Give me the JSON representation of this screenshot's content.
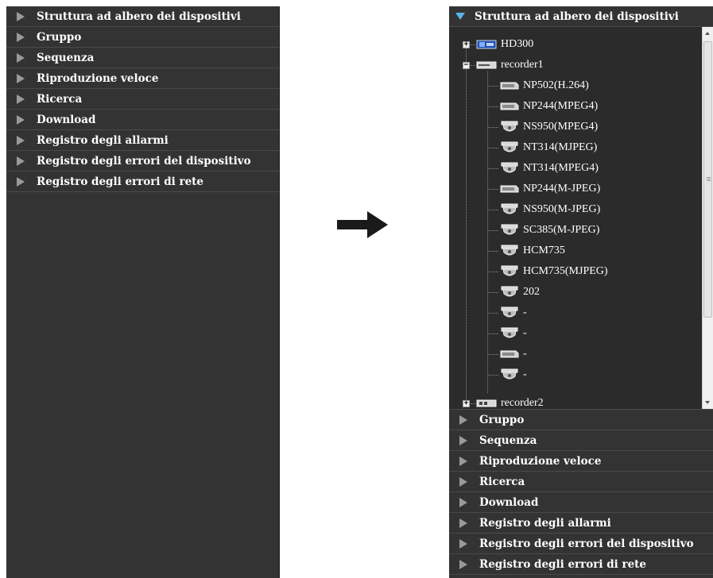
{
  "left_panel": {
    "items": [
      {
        "label": "Struttura ad albero dei dispositivi"
      },
      {
        "label": "Gruppo"
      },
      {
        "label": "Sequenza"
      },
      {
        "label": "Riproduzione veloce"
      },
      {
        "label": "Ricerca"
      },
      {
        "label": "Download"
      },
      {
        "label": "Registro degli allarmi"
      },
      {
        "label": "Registro degli errori del dispositivo"
      },
      {
        "label": "Registro degli errori di rete"
      }
    ]
  },
  "right_panel": {
    "header": {
      "label": "Struttura ad albero dei dispositivi"
    },
    "tree": {
      "hd300": {
        "label": "HD300",
        "expander": "+"
      },
      "recorder1": {
        "label": "recorder1",
        "expander": "−",
        "children": [
          {
            "label": "NP502(H.264)",
            "icon": "box-camera-icon"
          },
          {
            "label": "NP244(MPEG4)",
            "icon": "box-camera-icon"
          },
          {
            "label": "NS950(MPEG4)",
            "icon": "dome-camera-icon"
          },
          {
            "label": "NT314(MJPEG)",
            "icon": "dome-camera-icon"
          },
          {
            "label": "NT314(MPEG4)",
            "icon": "dome-camera-icon"
          },
          {
            "label": "NP244(M-JPEG)",
            "icon": "box-camera-icon"
          },
          {
            "label": "NS950(M-JPEG)",
            "icon": "dome-camera-icon"
          },
          {
            "label": "SC385(M-JPEG)",
            "icon": "dome-camera-icon"
          },
          {
            "label": "HCM735",
            "icon": "dome-camera-icon"
          },
          {
            "label": "HCM735(MJPEG)",
            "icon": "dome-camera-icon"
          },
          {
            "label": "202",
            "icon": "dome-camera-icon"
          },
          {
            "label": "-",
            "icon": "dome-camera-icon"
          },
          {
            "label": "-",
            "icon": "dome-camera-icon"
          },
          {
            "label": "-",
            "icon": "box-camera-icon"
          },
          {
            "label": "-",
            "icon": "dome-camera-icon"
          }
        ]
      },
      "recorder2": {
        "label": "recorder2",
        "expander": "+"
      }
    },
    "items": [
      {
        "label": "Gruppo"
      },
      {
        "label": "Sequenza"
      },
      {
        "label": "Riproduzione veloce"
      },
      {
        "label": "Ricerca"
      },
      {
        "label": "Download"
      },
      {
        "label": "Registro degli allarmi"
      },
      {
        "label": "Registro degli errori del dispositivo"
      },
      {
        "label": "Registro degli errori di rete"
      }
    ]
  },
  "colors": {
    "panel_bg": "#333333",
    "header_triangle": "#5ab4e6",
    "collapsed_triangle": "#9a9a9a",
    "text": "#ffffff"
  }
}
